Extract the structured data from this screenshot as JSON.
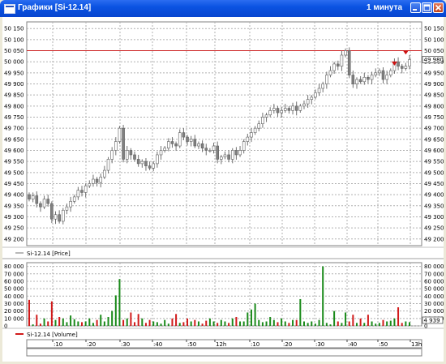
{
  "window": {
    "title": "Графики [Si-12.14]",
    "timeframe": "1 минута"
  },
  "price_panel": {
    "legend": "Si-12.14 [Price]",
    "current_value": "49 980",
    "reference_line": 50050,
    "ticks": [
      "50 150",
      "50 100",
      "50 050",
      "50 000",
      "49 950",
      "49 900",
      "49 850",
      "49 800",
      "49 750",
      "49 700",
      "49 650",
      "49 600",
      "49 550",
      "49 500",
      "49 450",
      "49 400",
      "49 350",
      "49 300",
      "49 250",
      "49 200"
    ]
  },
  "volume_panel": {
    "legend": "Si-12.14 [Volume]",
    "current_value": "4 939",
    "ticks": [
      "80 000",
      "70 000",
      "60 000",
      "50 000",
      "40 000",
      "30 000",
      "20 000",
      "10 000",
      "0"
    ]
  },
  "time_axis": {
    "labels": [
      ":10",
      ":20",
      ":30",
      ":40",
      ":50",
      "12h",
      ":10",
      ":20",
      ":30",
      ":40",
      ":50",
      "13h"
    ]
  },
  "colors": {
    "up": "#1a8a1a",
    "down": "#d11a1a",
    "candle": "#707070",
    "reference_line": "#cc2222",
    "marker": "#cc1111"
  },
  "chart_data": [
    {
      "type": "candlestick",
      "series": [
        {
          "name": "Si-12.14 [Price]",
          "values": [
            49380,
            49395,
            49360,
            49345,
            49380,
            49360,
            49290,
            49310,
            49280,
            49330,
            49345,
            49370,
            49390,
            49420,
            49410,
            49440,
            49450,
            49470,
            49455,
            49480,
            49510,
            49560,
            49600,
            49640,
            49700,
            49560,
            49600,
            49580,
            49560,
            49540,
            49550,
            49530,
            49520,
            49540,
            49580,
            49600,
            49610,
            49640,
            49630,
            49620,
            49680,
            49660,
            49640,
            49650,
            49620,
            49630,
            49610,
            49600,
            49600,
            49620,
            49560,
            49570,
            49580,
            49560,
            49600,
            49580,
            49600,
            49640,
            49660,
            49680,
            49700,
            49720,
            49750,
            49760,
            49780,
            49790,
            49770,
            49780,
            49790,
            49780,
            49800,
            49780,
            49800,
            49810,
            49830,
            49840,
            49860,
            49880,
            49900,
            49940,
            49960,
            49990,
            49980,
            50030,
            50050,
            49940,
            49900,
            49920,
            49910,
            49930,
            49920,
            49940,
            49950,
            49960,
            49920,
            49940,
            49960,
            50000,
            49980,
            49970,
            49980,
            50010
          ]
        }
      ],
      "ylim": [
        49170,
        50180
      ],
      "reference_value": 50050
    },
    {
      "type": "bar",
      "series": [
        {
          "name": "Si-12.14 [Volume]",
          "values": [
            35000,
            2000,
            15000,
            3000,
            10000,
            6000,
            33000,
            8000,
            12000,
            10000,
            5000,
            14000,
            9000,
            6000,
            5000,
            6000,
            10000,
            4000,
            8000,
            15000,
            6000,
            12000,
            20000,
            41000,
            63000,
            8000,
            10000,
            18000,
            5000,
            16000,
            10000,
            4000,
            8000,
            6000,
            5000,
            3000,
            8000,
            3000,
            10000,
            16000,
            4000,
            5000,
            10000,
            6000,
            8000,
            6000,
            3000,
            7000,
            10000,
            6000,
            4000,
            8000,
            6000,
            4000,
            10000,
            12000,
            6000,
            6000,
            18000,
            22000,
            30000,
            8000,
            5000,
            6000,
            12000,
            8000,
            5000,
            10000,
            6000,
            4000,
            8000,
            8000,
            36000,
            6000,
            4000,
            6000,
            3000,
            8000,
            80000,
            4000,
            2000,
            20000,
            6000,
            4000,
            18000,
            6000,
            15000,
            4000,
            10000,
            4000,
            15000,
            6000,
            3000,
            4000,
            8000,
            6000,
            7000,
            10000,
            25000,
            4000,
            6000,
            5000
          ]
        }
      ],
      "ylim": [
        0,
        85000
      ]
    }
  ]
}
